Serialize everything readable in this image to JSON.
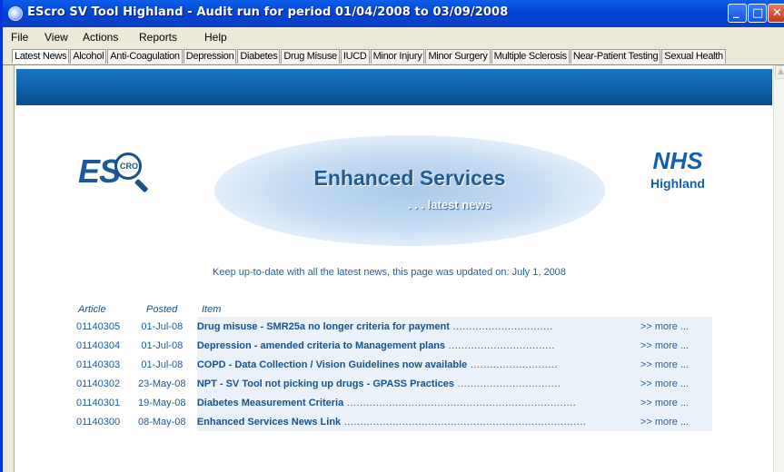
{
  "window": {
    "title": "EScro SV Tool Highland - Audit run for period 01/04/2008 to 03/09/2008",
    "controls": {
      "minimize": "_",
      "maximize": "□",
      "close": "✕"
    }
  },
  "menubar": {
    "items": [
      {
        "label": "File"
      },
      {
        "label": "View"
      },
      {
        "label": "Actions"
      },
      {
        "label": "Reports"
      },
      {
        "label": "Help"
      }
    ]
  },
  "tabs": [
    {
      "label": "Latest News",
      "active": true
    },
    {
      "label": "Alcohol"
    },
    {
      "label": "Anti-Coagulation"
    },
    {
      "label": "Depression"
    },
    {
      "label": "Diabetes"
    },
    {
      "label": "Drug Misuse"
    },
    {
      "label": "IUCD"
    },
    {
      "label": "Minor Injury"
    },
    {
      "label": "Minor Surgery"
    },
    {
      "label": "Multiple Sclerosis"
    },
    {
      "label": "Near-Patient Testing"
    },
    {
      "label": "Sexual Health"
    }
  ],
  "page": {
    "logo_es": "ES",
    "logo_cro": "CRO",
    "banner_title": "Enhanced Services",
    "banner_sub": ". . . latest news",
    "nhs_logo": "NHS",
    "nhs_region": "Highland",
    "update_text": "Keep up-to-date with all the latest news, this page was updated on: July 1, 2008",
    "headers": {
      "article": "Article",
      "posted": "Posted",
      "item": "Item"
    },
    "more_label": ">> more ..."
  },
  "news": [
    {
      "article": "01140305",
      "posted": "01-Jul-08",
      "item": "Drug misuse - SMR25a no longer criteria for payment",
      "dots": " ..............................."
    },
    {
      "article": "01140304",
      "posted": "01-Jul-08",
      "item": "Depression - amended criteria to Management plans",
      "dots": " ................................."
    },
    {
      "article": "01140303",
      "posted": "01-Jul-08",
      "item": "COPD - Data Collection / Vision Guidelines now available",
      "dots": " ..........................."
    },
    {
      "article": "01140302",
      "posted": "23-May-08",
      "item": "NPT - SV Tool not picking up drugs - GPASS Practices",
      "dots": " ................................"
    },
    {
      "article": "01140301",
      "posted": "19-May-08",
      "item": "Diabetes Measurement Criteria",
      "dots": " ......................................................................."
    },
    {
      "article": "01140300",
      "posted": "08-May-08",
      "item": "Enhanced Services News Link",
      "dots": " ..........................................................................."
    }
  ]
}
